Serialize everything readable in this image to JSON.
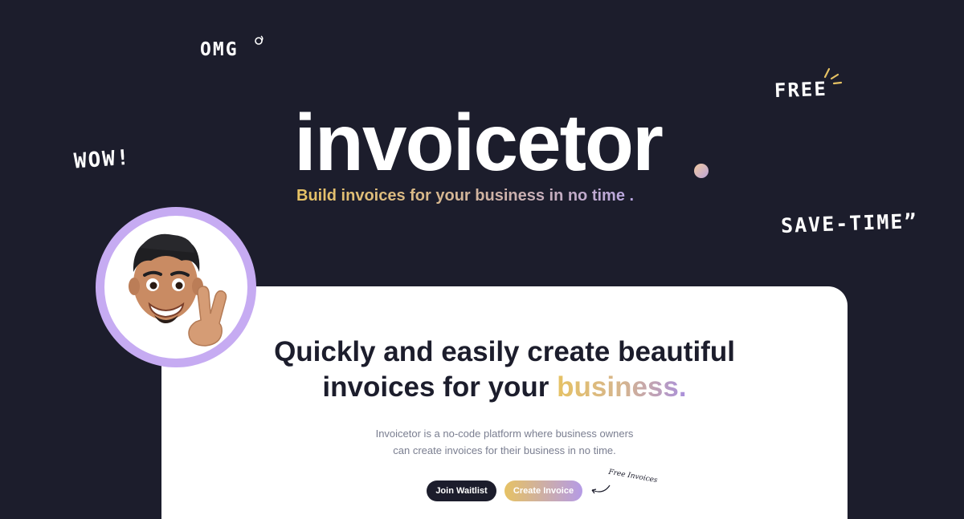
{
  "doodles": {
    "omg": "OMG",
    "wow": "WOW!",
    "free": "FREE",
    "save_time": "SAVE-TIME”"
  },
  "brand": {
    "name": "invoicetor",
    "tagline": "Build invoices for your business in no time ."
  },
  "card": {
    "headline_line1": "Quickly and easily create beautiful",
    "headline_line2": "invoices for your ",
    "headline_accent": "business.",
    "description_line1": "Invoicetor is a no-code platform where business owners",
    "description_line2": "can create invoices for their business in no time.",
    "join_label": "Join Waitlist",
    "create_label": "Create Invoice",
    "annotation": "Free Invoices"
  },
  "colors": {
    "background": "#1c1d2c",
    "accent_gold": "#e6c264",
    "accent_purple": "#b59be6",
    "avatar_ring": "#c6abf2"
  }
}
